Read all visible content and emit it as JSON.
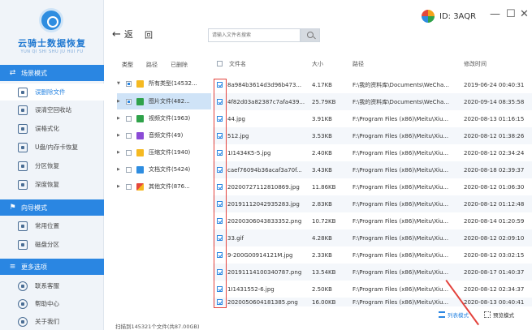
{
  "app": {
    "logo_title": "云骑士数据恢复",
    "logo_subtitle": "YUN QI SHI SHU JU HUI FU"
  },
  "sidebar": {
    "sections": [
      {
        "title": "场景模式",
        "items": [
          "误删除文件",
          "误清空回收站",
          "误格式化",
          "U盘/内存卡恢复",
          "分区恢复",
          "深度恢复"
        ]
      },
      {
        "title": "向导模式",
        "items": [
          "常用位置",
          "磁盘分区"
        ]
      },
      {
        "title": "更多选项",
        "items": [
          "联系客服",
          "帮助中心",
          "关于我们"
        ]
      }
    ],
    "active_item": "误删除文件"
  },
  "header": {
    "back_label": "返",
    "home_label": "回",
    "search_placeholder": "请输入文件名搜索",
    "id_label": "ID: 3AQR",
    "window_controls": [
      "—",
      "☐",
      "✕"
    ]
  },
  "tree": {
    "tabs": [
      "类型",
      "路径",
      "已删除"
    ],
    "rows": [
      {
        "label": "所有类型(14532...",
        "color": "#f5b921"
      },
      {
        "label": "图片文件(482...",
        "color": "#2fa24a"
      },
      {
        "label": "视频文件(1963)",
        "color": "#2fa24a"
      },
      {
        "label": "音频文件(49)",
        "color": "#8b4bd6"
      },
      {
        "label": "压缩文件(1940)",
        "color": "#f5b921"
      },
      {
        "label": "文档文件(5424)",
        "color": "#2e8de0"
      },
      {
        "label": "其他文件(876...",
        "color": "#e5483b"
      }
    ]
  },
  "table": {
    "headers": {
      "name": "文件名",
      "size": "大小",
      "path": "路径",
      "time": "修改时间"
    },
    "rows": [
      {
        "name": "8a984b3614d3d96b473...",
        "size": "4.17KB",
        "path": "F:\\我的资料库\\Documents\\WeCha...",
        "time": "2019-06-24 00:40:31"
      },
      {
        "name": "4f82d03a82387c7afa439...",
        "size": "25.79KB",
        "path": "F:\\我的资料库\\Documents\\WeCha...",
        "time": "2020-09-14 08:35:58"
      },
      {
        "name": "44.jpg",
        "size": "3.91KB",
        "path": "F:\\Program Files (x86)\\Meitu\\Xiu...",
        "time": "2020-08-13 01:16:15"
      },
      {
        "name": "512.jpg",
        "size": "3.53KB",
        "path": "F:\\Program Files (x86)\\Meitu\\Xiu...",
        "time": "2020-08-12 01:38:26"
      },
      {
        "name": "1I1434K5-5.jpg",
        "size": "2.40KB",
        "path": "F:\\Program Files (x86)\\Meitu\\Xiu...",
        "time": "2020-08-12 02:34:24"
      },
      {
        "name": "caef76094b36acaf3a70f...",
        "size": "3.43KB",
        "path": "F:\\Program Files (x86)\\Meitu\\Xiu...",
        "time": "2020-08-18 02:39:37"
      },
      {
        "name": "20200727112810869.jpg",
        "size": "11.86KB",
        "path": "F:\\Program Files (x86)\\Meitu\\Xiu...",
        "time": "2020-08-12 01:06:30"
      },
      {
        "name": "20191112042935283.jpg",
        "size": "2.83KB",
        "path": "F:\\Program Files (x86)\\Meitu\\Xiu...",
        "time": "2020-08-12 01:12:48"
      },
      {
        "name": "20200306043833352.png",
        "size": "10.72KB",
        "path": "F:\\Program Files (x86)\\Meitu\\Xiu...",
        "time": "2020-08-14 01:20:59"
      },
      {
        "name": "33.gif",
        "size": "4.28KB",
        "path": "F:\\Program Files (x86)\\Meitu\\Xiu...",
        "time": "2020-08-12 02:09:10"
      },
      {
        "name": "9-200G00914121M.jpg",
        "size": "2.33KB",
        "path": "F:\\Program Files (x86)\\Meitu\\Xiu...",
        "time": "2020-08-12 03:02:15"
      },
      {
        "name": "20191114100340787.png",
        "size": "13.54KB",
        "path": "F:\\Program Files (x86)\\Meitu\\Xiu...",
        "time": "2020-08-17 01:40:37"
      },
      {
        "name": "1I1431552-6.jpg",
        "size": "2.50KB",
        "path": "F:\\Program Files (x86)\\Meitu\\Xiu...",
        "time": "2020-08-12 02:34:37"
      },
      {
        "name": "2020050604181385.png",
        "size": "16.00KB",
        "path": "F:\\Program Files (x86)\\Meitu\\Xiu...",
        "time": "2020-08-13 00:40:41"
      }
    ]
  },
  "footer": {
    "status": "扫描到145321个文件(共87.00GB)",
    "list_mode": "列表模式",
    "thumb_mode": "预览模式"
  },
  "colors": {
    "accent": "#2a86e2",
    "sidebar_bg": "#f0f4f9",
    "highlight_box": "#e3423c"
  }
}
